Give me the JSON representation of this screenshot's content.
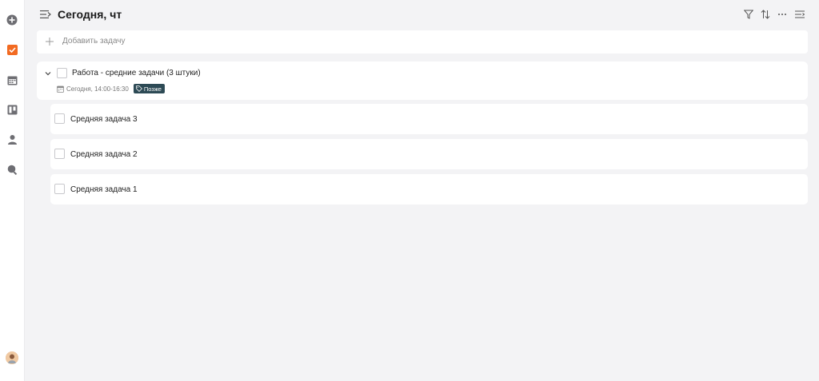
{
  "sidebar": {
    "items": [
      {
        "name": "add",
        "icon": "plus-circle-icon"
      },
      {
        "name": "tasks",
        "icon": "checkbox-icon",
        "active": true
      },
      {
        "name": "calendar",
        "icon": "calendar-icon"
      },
      {
        "name": "board",
        "icon": "kanban-icon"
      },
      {
        "name": "contacts",
        "icon": "person-icon"
      },
      {
        "name": "search",
        "icon": "search-icon"
      }
    ],
    "accent_color": "#f26a21"
  },
  "header": {
    "title": "Сегодня, чт",
    "tools": [
      "filter-icon",
      "sort-icon",
      "more-icon",
      "view-options-icon"
    ]
  },
  "add_task": {
    "placeholder": "Добавить задачу"
  },
  "group": {
    "title": "Работа - средние задачи (3 штуки)",
    "date": "Сегодня, 14:00-16:30",
    "tag": "Позже",
    "tag_color": "#2d4a55",
    "expanded": true
  },
  "subtasks": [
    {
      "title": "Средняя задача 3",
      "done": false
    },
    {
      "title": "Средняя задача 2",
      "done": false
    },
    {
      "title": "Средняя задача 1",
      "done": false
    }
  ]
}
